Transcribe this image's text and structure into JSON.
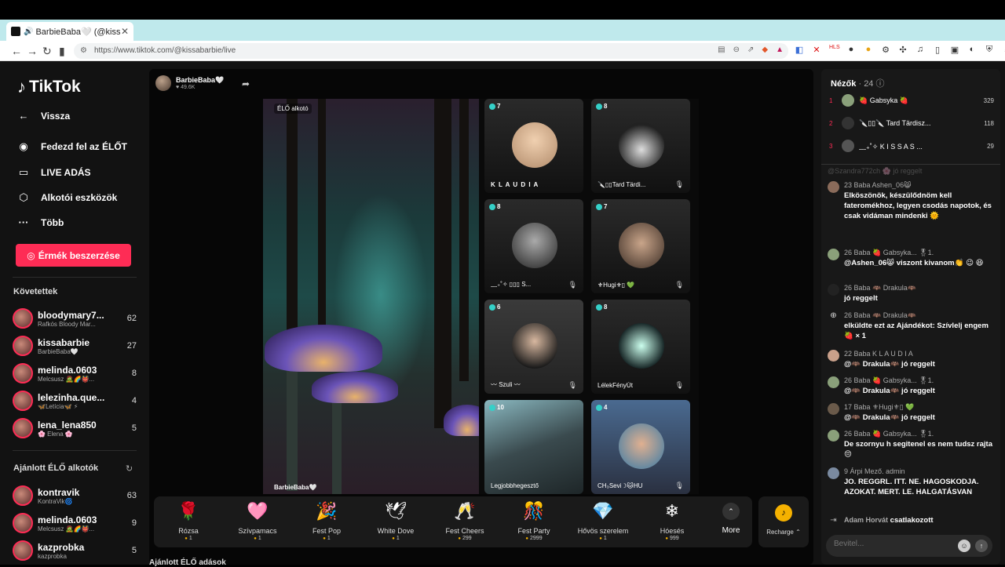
{
  "browser": {
    "tab_title": "BarbieBaba🤍 (@kissabarbie",
    "url": "https://www.tiktok.com/@kissabarbie/live",
    "new_tab": "+",
    "min": "—",
    "max": "▢",
    "close": "✕"
  },
  "sidebar": {
    "logo": "TikTok",
    "nav": [
      {
        "label": "Vissza",
        "icon": "←"
      },
      {
        "label": "Fedezd fel az ÉLŐT",
        "icon": "◉"
      },
      {
        "label": "LIVE ADÁS",
        "icon": "▭"
      },
      {
        "label": "Alkotói eszközök",
        "icon": "⬡"
      },
      {
        "label": "Több",
        "icon": "···"
      }
    ],
    "coin_button": "Érmék beszerzése",
    "following_title": "Követettek",
    "following": [
      {
        "name": "bloodymary7...",
        "sub": "Rafkós Bloody Mar...",
        "count": "62"
      },
      {
        "name": "kissabarbie",
        "sub": "BarbieBaba🤍",
        "count": "27"
      },
      {
        "name": "melinda.0603",
        "sub": "Melcsusz 🧟🌈👹...",
        "count": "8"
      },
      {
        "name": "lelezinha.que...",
        "sub": "🦋Letícia🦋 ⚡",
        "count": "4"
      },
      {
        "name": "lena_lena850",
        "sub": "🌸 Elena 🌸",
        "count": "5"
      }
    ],
    "suggested_title": "Ajánlott ÉLŐ alkotók",
    "suggested": [
      {
        "name": "kontravik",
        "sub": "KontraVik🌀",
        "count": "63"
      },
      {
        "name": "melinda.0603",
        "sub": "Melcsusz 🧟🌈👹...",
        "count": "9"
      },
      {
        "name": "kazprobka",
        "sub": "kazprobka",
        "count": "5"
      }
    ]
  },
  "stream": {
    "host_name": "BarbieBaba🤍",
    "host_likes": "♥ 49.6K",
    "live_tag": "ÉLŐ alkotó",
    "video_name": "BarbieBaba🤍",
    "guests": [
      {
        "score": "7",
        "name": "K L A U D I A"
      },
      {
        "score": "8",
        "name": "🔪▯▯Tard Tärdi..."
      },
      {
        "score": "8",
        "name": "﹏₊˚✧ ▯▯▯ S..."
      },
      {
        "score": "7",
        "name": "⚜Hugi⚜▯ 💚"
      },
      {
        "score": "6",
        "name": "〰 Szuli 〰"
      },
      {
        "score": "8",
        "name": "LélekFényÚt"
      },
      {
        "score": "10",
        "name": "Legjobbhegesztő"
      },
      {
        "score": "4",
        "name": "CH₃Sevi☽🐱HU"
      }
    ],
    "gifts": [
      {
        "name": "Rózsa",
        "price": "1",
        "icon": "🌹"
      },
      {
        "name": "Szívpamacs",
        "price": "1",
        "icon": "🩷"
      },
      {
        "name": "Fest Pop",
        "price": "1",
        "icon": "🎉"
      },
      {
        "name": "White Dove",
        "price": "1",
        "icon": "🕊"
      },
      {
        "name": "Fest Cheers",
        "price": "299",
        "icon": "🥂"
      },
      {
        "name": "Fest Party",
        "price": "2999",
        "icon": "🎊"
      },
      {
        "name": "Hővös szerelem",
        "price": "1",
        "icon": "💎"
      },
      {
        "name": "Hóesés",
        "price": "999",
        "icon": "❄"
      }
    ],
    "more_label": "More",
    "recharge_label": "Recharge ⌃",
    "bottom_heading": "Ajánlott ÉLŐ adások"
  },
  "chat": {
    "viewers_title": "Nézők",
    "viewers_count": "· 24",
    "ranking": [
      {
        "rank": "1",
        "name": "🍓 Gabsyka 🍓",
        "points": "329"
      },
      {
        "rank": "2",
        "name": "🔪▯▯🔪 Tard Tärdisz...",
        "points": "118"
      },
      {
        "rank": "3",
        "name": "﹏₊˚✧ K I S S A S ...",
        "points": "29"
      }
    ],
    "faded_message": "@Szandra772ch 🌸 jó reggelt",
    "messages": [
      {
        "meta": "23 Baba Ashen_06😸",
        "text": "Elköszönök, készülődnöm kell fateromékhoz, legyen csodás napotok, és csak vidáman mindenki 🌞"
      },
      {
        "meta": "26 Baba 🍓 Gabsyka... 🎖1.",
        "text": "@Ashen_06😸 viszont kivanom👏 😉 😆"
      },
      {
        "meta": "26 Baba 🦇 Drakula🦇",
        "text": "jó reggelt"
      },
      {
        "meta": "26 Baba 🦇 Drakula🦇",
        "text": "elküldte ezt az Ajándékot: Szívlelj engem 🍓 × 1"
      },
      {
        "meta": "22 Baba K L A U D I A",
        "text": "@🦇 Drakula🦇 jó reggelt"
      },
      {
        "meta": "26 Baba 🍓 Gabsyka... 🎖1.",
        "text": "@🦇 Drakula🦇 jó reggelt"
      },
      {
        "meta": "17 Baba ⚜Hugi⚜▯ 💚",
        "text": "@🦇 Drakula🦇 jó reggelt"
      },
      {
        "meta": "26 Baba 🍓 Gabsyka... 🎖1.",
        "text": "De szornyu h segitenel es nem tudsz rajta😔"
      },
      {
        "meta": "9 Árpi Mező. admin",
        "text": "JO. REGGRL. ITT. NE. HAGOSKODJA. AZOKAT. MERT. LE. HALGATÁSVAN"
      }
    ],
    "join_name": "Adam Horvát",
    "join_text": "csatlakozott",
    "input_placeholder": "Bevitel..."
  },
  "colors": {
    "accent": "#fe2c55",
    "background": "#121212",
    "coin": "#f5b100",
    "teal": "#35d0c8"
  }
}
